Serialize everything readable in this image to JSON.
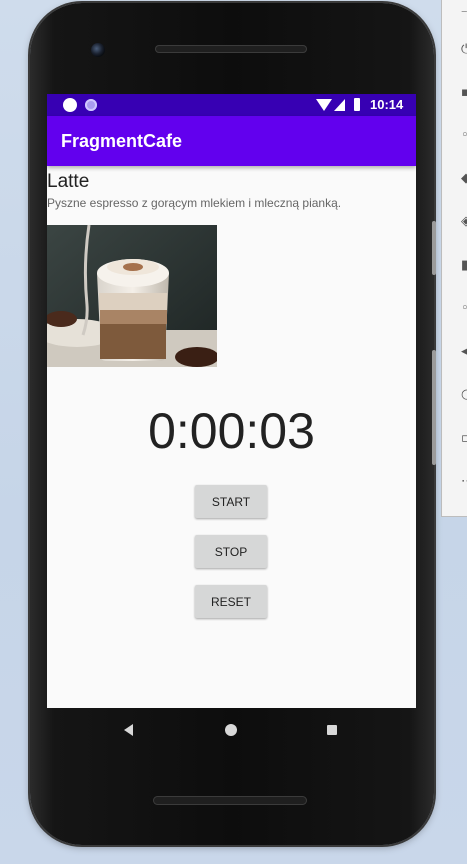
{
  "status_bar": {
    "time": "10:14"
  },
  "app_bar": {
    "title": "FragmentCafe"
  },
  "drink": {
    "name": "Latte",
    "description": "Pyszne espresso z gorącym mlekiem i mleczną pianką."
  },
  "stopwatch": {
    "time": "0:00:03",
    "start_label": "START",
    "stop_label": "STOP",
    "reset_label": "RESET"
  },
  "colors": {
    "status_bar": "#3700b3",
    "app_bar": "#6200ee",
    "button": "#d6d7d7",
    "screen_background": "#fafafa"
  },
  "icons": [
    "notification-icon",
    "wifi-icon",
    "signal-icon",
    "battery-icon",
    "back-icon",
    "home-icon",
    "recents-icon"
  ]
}
